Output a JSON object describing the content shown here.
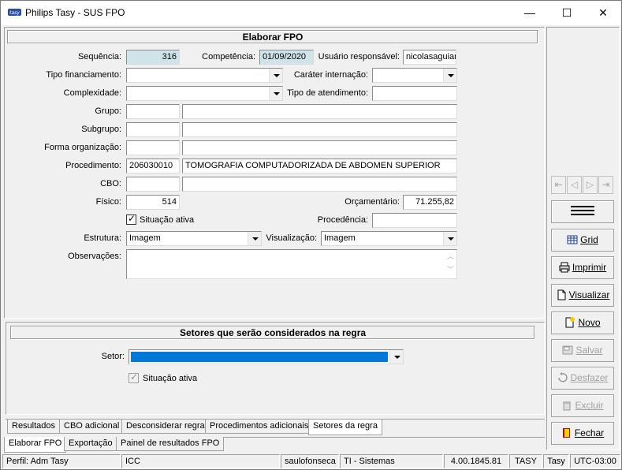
{
  "window": {
    "title": "Philips Tasy - SUS FPO",
    "controls": [
      "—",
      "☐",
      "✕"
    ]
  },
  "form": {
    "header": "Elaborar FPO",
    "sequencia_label": "Sequência:",
    "sequencia_value": "316",
    "competencia_label": "Competência:",
    "competencia_value": "01/09/2020",
    "usuario_label": "Usuário responsável:",
    "usuario_value": "nicolasaguiar",
    "tipo_fin_label": "Tipo financiamento:",
    "tipo_fin_value": "",
    "carater_label": "Caráter internação:",
    "carater_value": "",
    "complexidade_label": "Complexidade:",
    "complexidade_value": "",
    "tipo_atend_label": "Tipo de atendimento:",
    "tipo_atend_value": "",
    "grupo_label": "Grupo:",
    "grupo_code": "",
    "grupo_desc": "",
    "subgrupo_label": "Subgrupo:",
    "subgrupo_code": "",
    "subgrupo_desc": "",
    "forma_label": "Forma organização:",
    "forma_code": "",
    "forma_desc": "",
    "procedimento_label": "Procedimento:",
    "procedimento_code": "206030010",
    "procedimento_desc": "TOMOGRAFIA COMPUTADORIZADA DE ABDOMEN SUPERIOR",
    "cbo_label": "CBO:",
    "cbo_code": "",
    "cbo_desc": "",
    "fisico_label": "Físico:",
    "fisico_value": "514",
    "orcamentario_label": "Orçamentário:",
    "orcamentario_value": "71.255,82",
    "situacao_label": "Situação ativa",
    "situacao_checked": true,
    "procedencia_label": "Procedência:",
    "procedencia_value": "",
    "estrutura_label": "Estrutura:",
    "estrutura_value": "Imagem",
    "visualizacao_label": "Visualização:",
    "visualizacao_value": "Imagem",
    "observacoes_label": "Observações:",
    "observacoes_value": ""
  },
  "setores": {
    "header": "Setores que serão considerados na regra",
    "setor_label": "Setor:",
    "setor_value": "",
    "situacao_label": "Situação ativa",
    "situacao_checked": true
  },
  "inner_tabs": [
    "Resultados",
    "CBO adicional",
    "Desconsiderar regra",
    "Procedimentos adicionais",
    "Setores da regra"
  ],
  "inner_tab_active": "Setores da regra",
  "outer_tabs": [
    "Elaborar FPO",
    "Exportação",
    "Painel de resultados FPO"
  ],
  "outer_tab_active": "Elaborar FPO",
  "sidebar": {
    "nav": [
      "⇤",
      "◁",
      "▷",
      "⇥"
    ],
    "menu_icon": "hamburger-icon",
    "buttons": [
      {
        "label": "Grid",
        "icon": "grid-icon",
        "enabled": true
      },
      {
        "label": "Imprimir",
        "icon": "printer-icon",
        "enabled": true
      },
      {
        "label": "Visualizar",
        "icon": "document-icon",
        "enabled": true
      },
      {
        "label": "Novo",
        "icon": "new-document-icon",
        "enabled": true
      },
      {
        "label": "Salvar",
        "icon": "save-icon",
        "enabled": false
      },
      {
        "label": "Desfazer",
        "icon": "undo-icon",
        "enabled": false
      },
      {
        "label": "Excluir",
        "icon": "trash-icon",
        "enabled": false
      },
      {
        "label": "Fechar",
        "icon": "exit-icon",
        "enabled": true
      }
    ]
  },
  "statusbar": {
    "perfil": "Perfil: Adm Tasy",
    "estab": "ICC",
    "usuario": "saulofonseca",
    "setor": "TI - Sistemas",
    "versao": "4.00.1845.81",
    "banco": "TASY",
    "sistema": "Tasy",
    "fuso": "UTC-03:00"
  },
  "colors": {
    "readonly_field": "#cfe4e8",
    "selection_blue": "#0078d7",
    "button_face": "#f0f0f0"
  }
}
